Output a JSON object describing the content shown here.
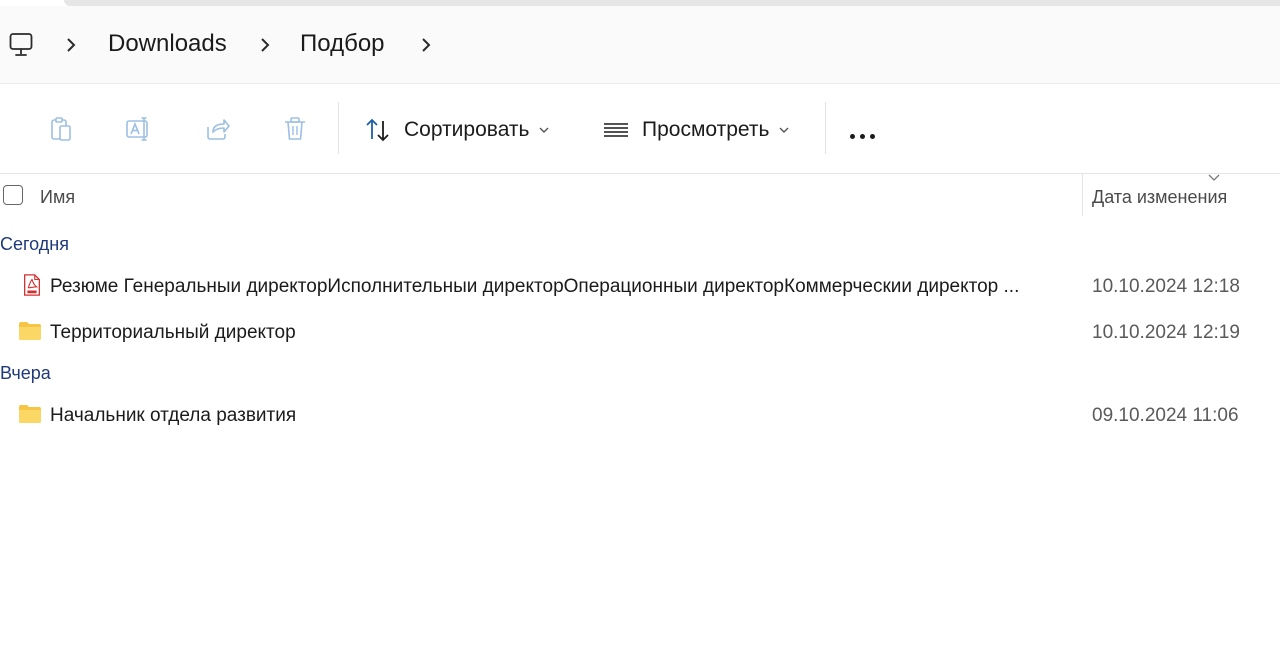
{
  "breadcrumb": {
    "items": [
      "Downloads",
      "Подбор"
    ]
  },
  "toolbar": {
    "sort_label": "Сортировать",
    "view_label": "Просмотреть"
  },
  "columns": {
    "name": "Имя",
    "date": "Дата изменения"
  },
  "groups": [
    {
      "label": "Сегодня",
      "rows": [
        {
          "type": "pdf",
          "name": "Резюме Генеральныи  директорИсполнительныи директорОперационныи директорКоммерческии директор ...",
          "date": "10.10.2024 12:18"
        },
        {
          "type": "folder",
          "name": "Территориальный директор",
          "date": "10.10.2024 12:19"
        }
      ]
    },
    {
      "label": "Вчера",
      "rows": [
        {
          "type": "folder",
          "name": "Начальник отдела развития",
          "date": "09.10.2024 11:06"
        }
      ]
    }
  ],
  "colors": {
    "group_label": "#1f3a78",
    "folder": "#f6c545",
    "pdf_red": "#d32f2f",
    "disabled_icon": "#9dbfe3"
  }
}
